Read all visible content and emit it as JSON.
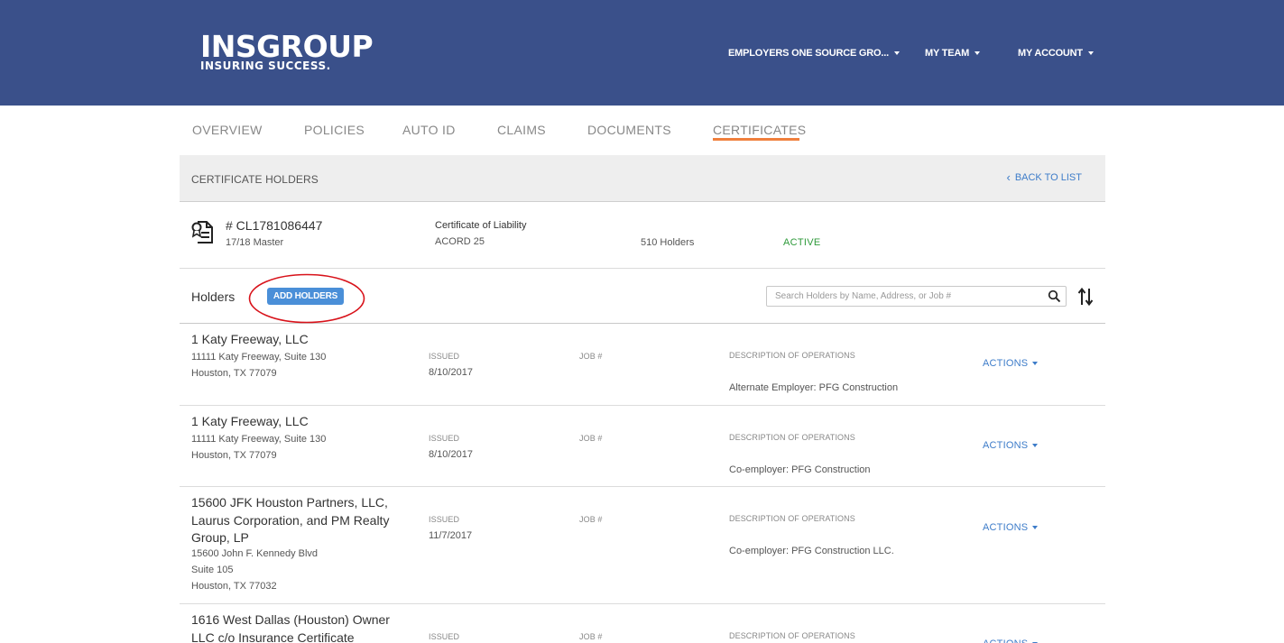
{
  "header": {
    "logo_main": "INSGROUP",
    "logo_tagline": "INSURING SUCCESS.",
    "nav": [
      {
        "label": "EMPLOYERS ONE SOURCE GRO..."
      },
      {
        "label": "MY TEAM"
      },
      {
        "label": "MY ACCOUNT"
      }
    ]
  },
  "tabs": [
    {
      "label": "OVERVIEW"
    },
    {
      "label": "POLICIES"
    },
    {
      "label": "AUTO ID"
    },
    {
      "label": "CLAIMS"
    },
    {
      "label": "DOCUMENTS"
    },
    {
      "label": "CERTIFICATES",
      "active": true
    }
  ],
  "panel": {
    "title": "CERTIFICATE HOLDERS",
    "back_label": "BACK TO LIST"
  },
  "certificate": {
    "number": "# CL1781086447",
    "subtitle": "17/18 Master",
    "type": "Certificate of Liability",
    "form": "ACORD 25",
    "holders_count": "510 Holders",
    "status": "ACTIVE"
  },
  "holders_toolbar": {
    "label": "Holders",
    "add_button": "ADD HOLDERS",
    "search_placeholder": "Search Holders by Name, Address, or Job #"
  },
  "column_labels": {
    "issued": "ISSUED",
    "job": "JOB #",
    "description": "DESCRIPTION OF OPERATIONS",
    "actions": "ACTIONS"
  },
  "holders": [
    {
      "name": "1 Katy Freeway, LLC",
      "address_lines": [
        "11111 Katy Freeway, Suite 130",
        "Houston, TX 77079"
      ],
      "issued": "8/10/2017",
      "job": "",
      "description": "Alternate Employer: PFG Construction"
    },
    {
      "name": "1 Katy Freeway, LLC",
      "address_lines": [
        "11111 Katy Freeway, Suite 130",
        "Houston, TX 77079"
      ],
      "issued": "8/10/2017",
      "job": "",
      "description": "Co-employer: PFG Construction"
    },
    {
      "name": "15600 JFK Houston Partners, LLC, Laurus Corporation, and PM Realty Group, LP",
      "address_lines": [
        "15600 John F. Kennedy Blvd",
        "Suite 105",
        "Houston, TX 77032"
      ],
      "issued": "11/7/2017",
      "job": "",
      "description": "Co-employer: PFG Construction LLC."
    },
    {
      "name": "1616 West Dallas (Houston) Owner LLC c/o Insurance Certificate",
      "address_lines": [],
      "issued": "",
      "job": "",
      "description": ""
    }
  ],
  "colors": {
    "header_bg": "#3a508a",
    "accent_orange": "#f07f3c",
    "link_blue": "#3d7cc9",
    "button_blue": "#4a8fd8",
    "status_green": "#2e9a3a",
    "annotation_red": "#d8121a"
  },
  "icons": {
    "certificate": "certificate-document-icon",
    "back": "chevron-left-icon",
    "search": "search-icon",
    "sort": "sort-arrows-icon",
    "dropdown": "caret-down-icon"
  }
}
